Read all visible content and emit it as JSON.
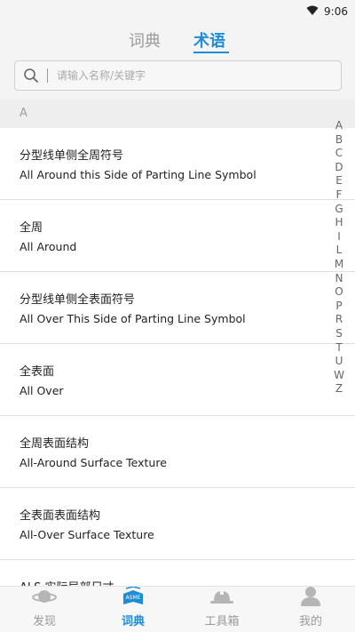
{
  "status_bar": {
    "time": "9:06"
  },
  "tabs": [
    {
      "label": "词典",
      "active": false
    },
    {
      "label": "术语",
      "active": true
    }
  ],
  "search": {
    "placeholder": "请输入名称/关键字",
    "value": ""
  },
  "section": "A",
  "terms": [
    {
      "cn": "分型线单侧全周符号",
      "en": "All Around this Side of Parting Line Symbol"
    },
    {
      "cn": "全周",
      "en": "All Around"
    },
    {
      "cn": "分型线单侧全表面符号",
      "en": "All Over This Side of Parting Line Symbol"
    },
    {
      "cn": "全表面",
      "en": "All Over"
    },
    {
      "cn": "全周表面结构",
      "en": "All-Around Surface Texture"
    },
    {
      "cn": "全表面表面结构",
      "en": "All-Over Surface Texture"
    },
    {
      "cn": "ALS  实际局部尺寸",
      "en": ""
    }
  ],
  "alphabet": [
    "A",
    "B",
    "C",
    "D",
    "E",
    "F",
    "G",
    "H",
    "I",
    "L",
    "M",
    "N",
    "O",
    "P",
    "R",
    "S",
    "T",
    "U",
    "W",
    "Z"
  ],
  "bottom_nav": [
    {
      "label": "发现",
      "icon": "planet-icon",
      "active": false
    },
    {
      "label": "词典",
      "icon": "asme-book-icon",
      "active": true,
      "badge": "ASME"
    },
    {
      "label": "工具箱",
      "icon": "hard-hat-icon",
      "active": false
    },
    {
      "label": "我的",
      "icon": "person-icon",
      "active": false
    }
  ],
  "colors": {
    "accent": "#1f8dd6",
    "inactive": "#9a9a9a"
  }
}
